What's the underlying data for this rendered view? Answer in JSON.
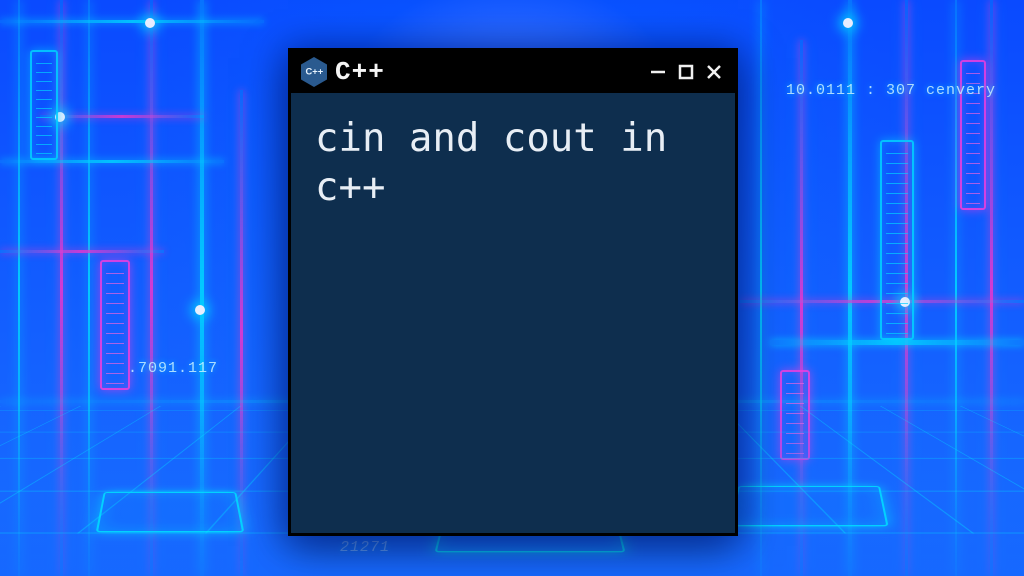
{
  "window": {
    "title": "C++",
    "icon_label": "C++",
    "content": "cin and cout in c++"
  },
  "background": {
    "text_fragments": {
      "top_right": "10.0111 : 307  cenvery",
      "left_numeric": ".7091.117",
      "bottom_numeric": "21271"
    }
  }
}
